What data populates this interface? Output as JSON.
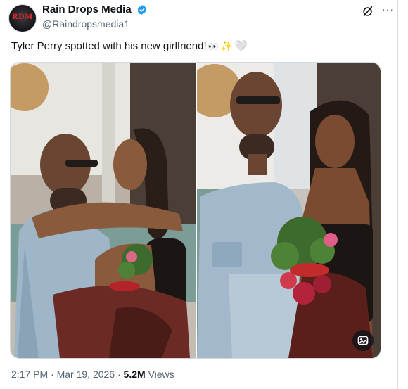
{
  "account": {
    "avatar_text": "RDM",
    "display_name": "Rain Drops Media",
    "handle": "@Raindropsmedia1",
    "verified": true
  },
  "header_icons": {
    "grok": "grok-icon",
    "more": "···"
  },
  "tweet": {
    "text": "Tyler Perry spotted with his new girlfriend!",
    "emojis": {
      "eyes": "👀",
      "sparkles": "✨",
      "heart": "🤍"
    }
  },
  "media": {
    "photo_count": 2,
    "alt_icon": "image-description-icon"
  },
  "meta": {
    "time": "2:17 PM",
    "separator": "·",
    "date": "Mar 19, 2026",
    "views_count": "5.2M",
    "views_label": "Views"
  },
  "colors": {
    "verified_blue": "#1d9bf0",
    "text_primary": "#0f1419",
    "text_secondary": "#536471",
    "border": "#cfd9de"
  }
}
